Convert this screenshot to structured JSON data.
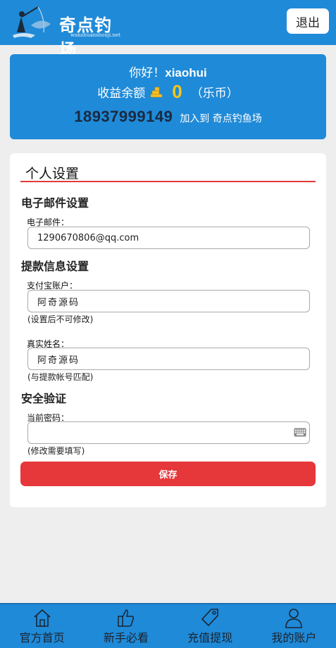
{
  "header": {
    "logo_title": "奇点钓场",
    "logo_subtitle": "wanzhuanshouji.net",
    "logout_label": "退出"
  },
  "account": {
    "greeting_prefix": "你好！",
    "username": "xiaohui",
    "balance_label": "收益余额",
    "balance_value": "0",
    "balance_unit": "（乐币）",
    "phone": "18937999149",
    "join_text": "加入到 奇点钓鱼场"
  },
  "settings": {
    "title": "个人设置",
    "email_section": "电子邮件设置",
    "email_label": "电子邮件：",
    "email_value": "1290670806@qq.com",
    "withdraw_section": "提款信息设置",
    "alipay_label": "支付宝账户：",
    "alipay_value": "阿奇源码",
    "alipay_hint": "(设置后不可修改)",
    "realname_label": "真实姓名：",
    "realname_value": "阿奇源码",
    "realname_hint": "(与提款帐号匹配)",
    "security_section": "安全验证",
    "password_label": "当前密码：",
    "password_value": "",
    "password_hint": "(修改需要填写)",
    "save_label": "保存"
  },
  "nav": {
    "items": [
      {
        "label": "官方首页",
        "icon": "home-icon"
      },
      {
        "label": "新手必看",
        "icon": "thumbs-up-icon"
      },
      {
        "label": "充值提现",
        "icon": "tag-icon"
      },
      {
        "label": "我的账户",
        "icon": "user-icon"
      }
    ]
  },
  "colors": {
    "primary": "#1f8ad8",
    "accent_red": "#e6373a",
    "balance_gold": "#f5c518"
  }
}
